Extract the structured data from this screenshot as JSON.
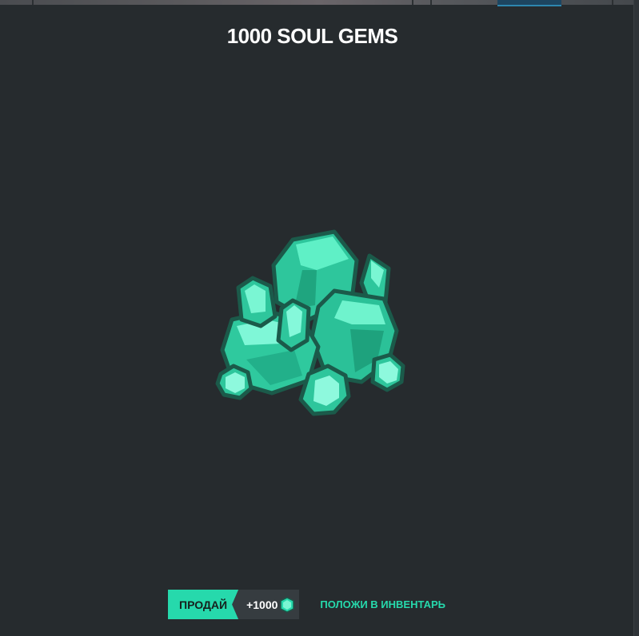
{
  "item": {
    "title": "1000 SOUL GEMS",
    "image_icon": "soul-gem-cluster-icon"
  },
  "actions": {
    "sell_label": "ПРОДАЙ",
    "sell_value": "+1000",
    "currency_icon": "soul-gem-icon",
    "inventory_label": "ПОЛОЖИ В ИНВЕНТАРЬ"
  },
  "colors": {
    "background": "#262b2e",
    "accent": "#26d9ac",
    "value_pill": "#363c40"
  }
}
